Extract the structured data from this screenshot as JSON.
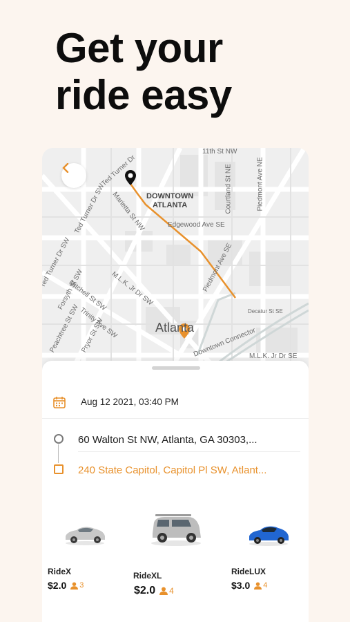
{
  "headline": {
    "line1": "Get your",
    "line2": "ride easy"
  },
  "map": {
    "downtown_line1": "DOWNTOWN",
    "downtown_line2": "ATLANTA",
    "city": "Atlanta",
    "streets": {
      "marietta": "Marietta St NW",
      "ted_turner_top": "Ted Turner Dr",
      "ted_turner_mid": "Ted Turner Dr SW",
      "ted_turner_low": "Ted Turner Dr SW",
      "edgewood": "Edgewood Ave SE",
      "courtland": "Courtland St NE",
      "piedmont_ne": "Piedmont Ave NE",
      "piedmont_se": "Piedmont Ave SE",
      "mlk": "M.L.K. Jr Dr SW",
      "mlk_se": "M.L.K. Jr Dr SE",
      "mitchell": "Mitchell St SW",
      "forsyth": "Forsyth St SW",
      "trinity": "Trinity Ave SW",
      "peachtree": "Peachtree St SW",
      "pryor": "Pryor St SW",
      "decatur": "Decatur St SE",
      "connector": "Downtown Connector",
      "top": "11th St NW"
    },
    "route_color": "#e8912c"
  },
  "trip": {
    "datetime": "Aug 12 2021, 03:40 PM",
    "origin": "60 Walton St NW, Atlanta, GA 30303,...",
    "destination": "240 State Capitol, Capitol Pl SW, Atlant..."
  },
  "rides": [
    {
      "name": "RideX",
      "price": "$2.0",
      "seats": "3",
      "color": "#c8c8c8"
    },
    {
      "name": "RideXL",
      "price": "$2.0",
      "seats": "4",
      "color": "#bdbdbd"
    },
    {
      "name": "RideLUX",
      "price": "$3.0",
      "seats": "4",
      "color": "#2166d1"
    }
  ],
  "accent_color": "#e8912c"
}
